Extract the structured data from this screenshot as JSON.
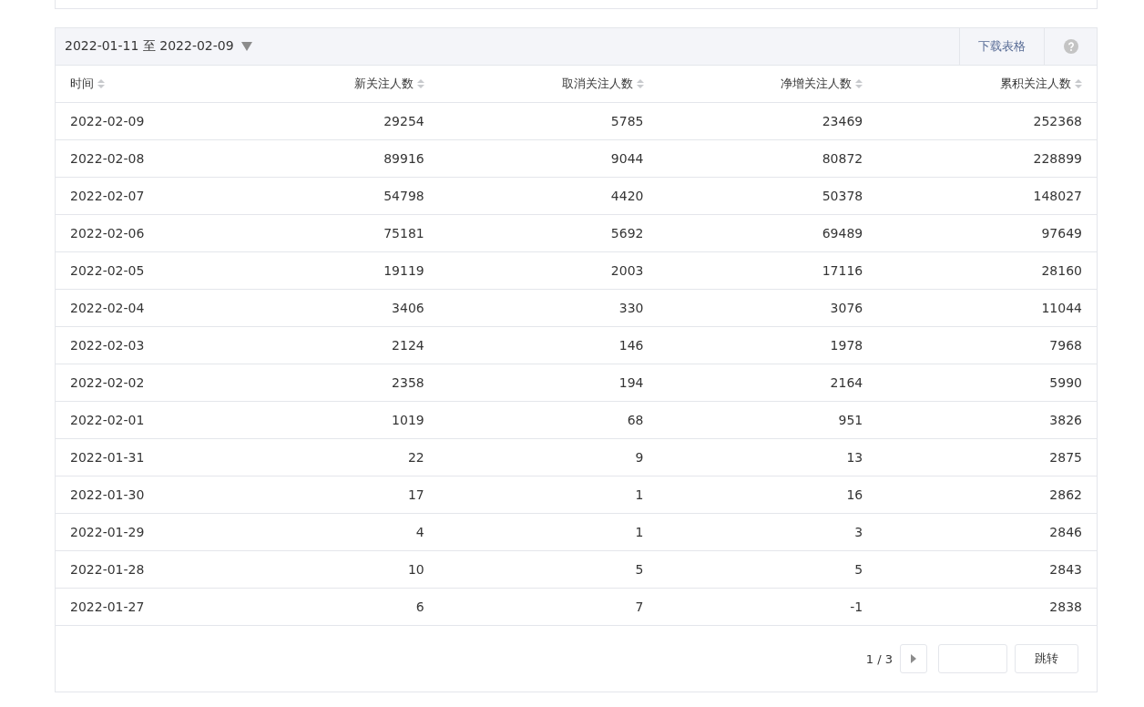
{
  "date_range": {
    "label": "2022-01-11 至 2022-02-09"
  },
  "download_link": "下载表格",
  "table": {
    "columns": [
      "时间",
      "新关注人数",
      "取消关注人数",
      "净增关注人数",
      "累积关注人数"
    ],
    "rows": [
      [
        "2022-02-09",
        "29254",
        "5785",
        "23469",
        "252368"
      ],
      [
        "2022-02-08",
        "89916",
        "9044",
        "80872",
        "228899"
      ],
      [
        "2022-02-07",
        "54798",
        "4420",
        "50378",
        "148027"
      ],
      [
        "2022-02-06",
        "75181",
        "5692",
        "69489",
        "97649"
      ],
      [
        "2022-02-05",
        "19119",
        "2003",
        "17116",
        "28160"
      ],
      [
        "2022-02-04",
        "3406",
        "330",
        "3076",
        "11044"
      ],
      [
        "2022-02-03",
        "2124",
        "146",
        "1978",
        "7968"
      ],
      [
        "2022-02-02",
        "2358",
        "194",
        "2164",
        "5990"
      ],
      [
        "2022-02-01",
        "1019",
        "68",
        "951",
        "3826"
      ],
      [
        "2022-01-31",
        "22",
        "9",
        "13",
        "2875"
      ],
      [
        "2022-01-30",
        "17",
        "1",
        "16",
        "2862"
      ],
      [
        "2022-01-29",
        "4",
        "1",
        "3",
        "2846"
      ],
      [
        "2022-01-28",
        "10",
        "5",
        "5",
        "2843"
      ],
      [
        "2022-01-27",
        "6",
        "7",
        "-1",
        "2838"
      ]
    ]
  },
  "pagination": {
    "page_info": "1 / 3",
    "jump_button": "跳转"
  }
}
